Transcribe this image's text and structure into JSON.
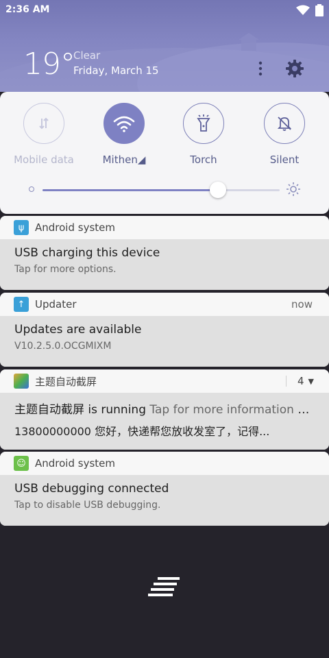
{
  "status_bar": {
    "time": "2:36 AM",
    "icons": [
      "wifi-icon",
      "battery-icon"
    ]
  },
  "weather": {
    "temperature": "19°",
    "condition": "Clear",
    "date": "Friday, March 15"
  },
  "quick_settings": {
    "toggles": [
      {
        "label": "Mobile data",
        "icon": "mobile-data-icon",
        "state": "disabled"
      },
      {
        "label": "Mithen◢",
        "icon": "wifi-icon",
        "state": "on"
      },
      {
        "label": "Torch",
        "icon": "torch-icon",
        "state": "off"
      },
      {
        "label": "Silent",
        "icon": "bell-icon",
        "state": "off"
      }
    ],
    "brightness_level": 0.74
  },
  "notifications": [
    {
      "app": "Android system",
      "title": "USB charging this device",
      "text": "Tap for more options.",
      "icon_color": "#3aa0d8"
    },
    {
      "app": "Updater",
      "time": "now",
      "title": "Updates are available",
      "text": "V10.2.5.0.OCGMIXM",
      "icon_color": "#3aa0d8"
    },
    {
      "app": "主题自动截屏",
      "count": "4",
      "title": "主题自动截屏 is running",
      "title_extra": "Tap for more information o...",
      "text": "13800000000 您好，快递帮您放收发室了，记得...",
      "icon_color": "#e0a53a"
    },
    {
      "app": "Android system",
      "title": "USB debugging connected",
      "text": "Tap to disable USB debugging.",
      "icon_color": "#6cc04a"
    }
  ],
  "colors": {
    "accent": "#7e81c3",
    "header": "#7f81bd",
    "background": "#25232b"
  }
}
